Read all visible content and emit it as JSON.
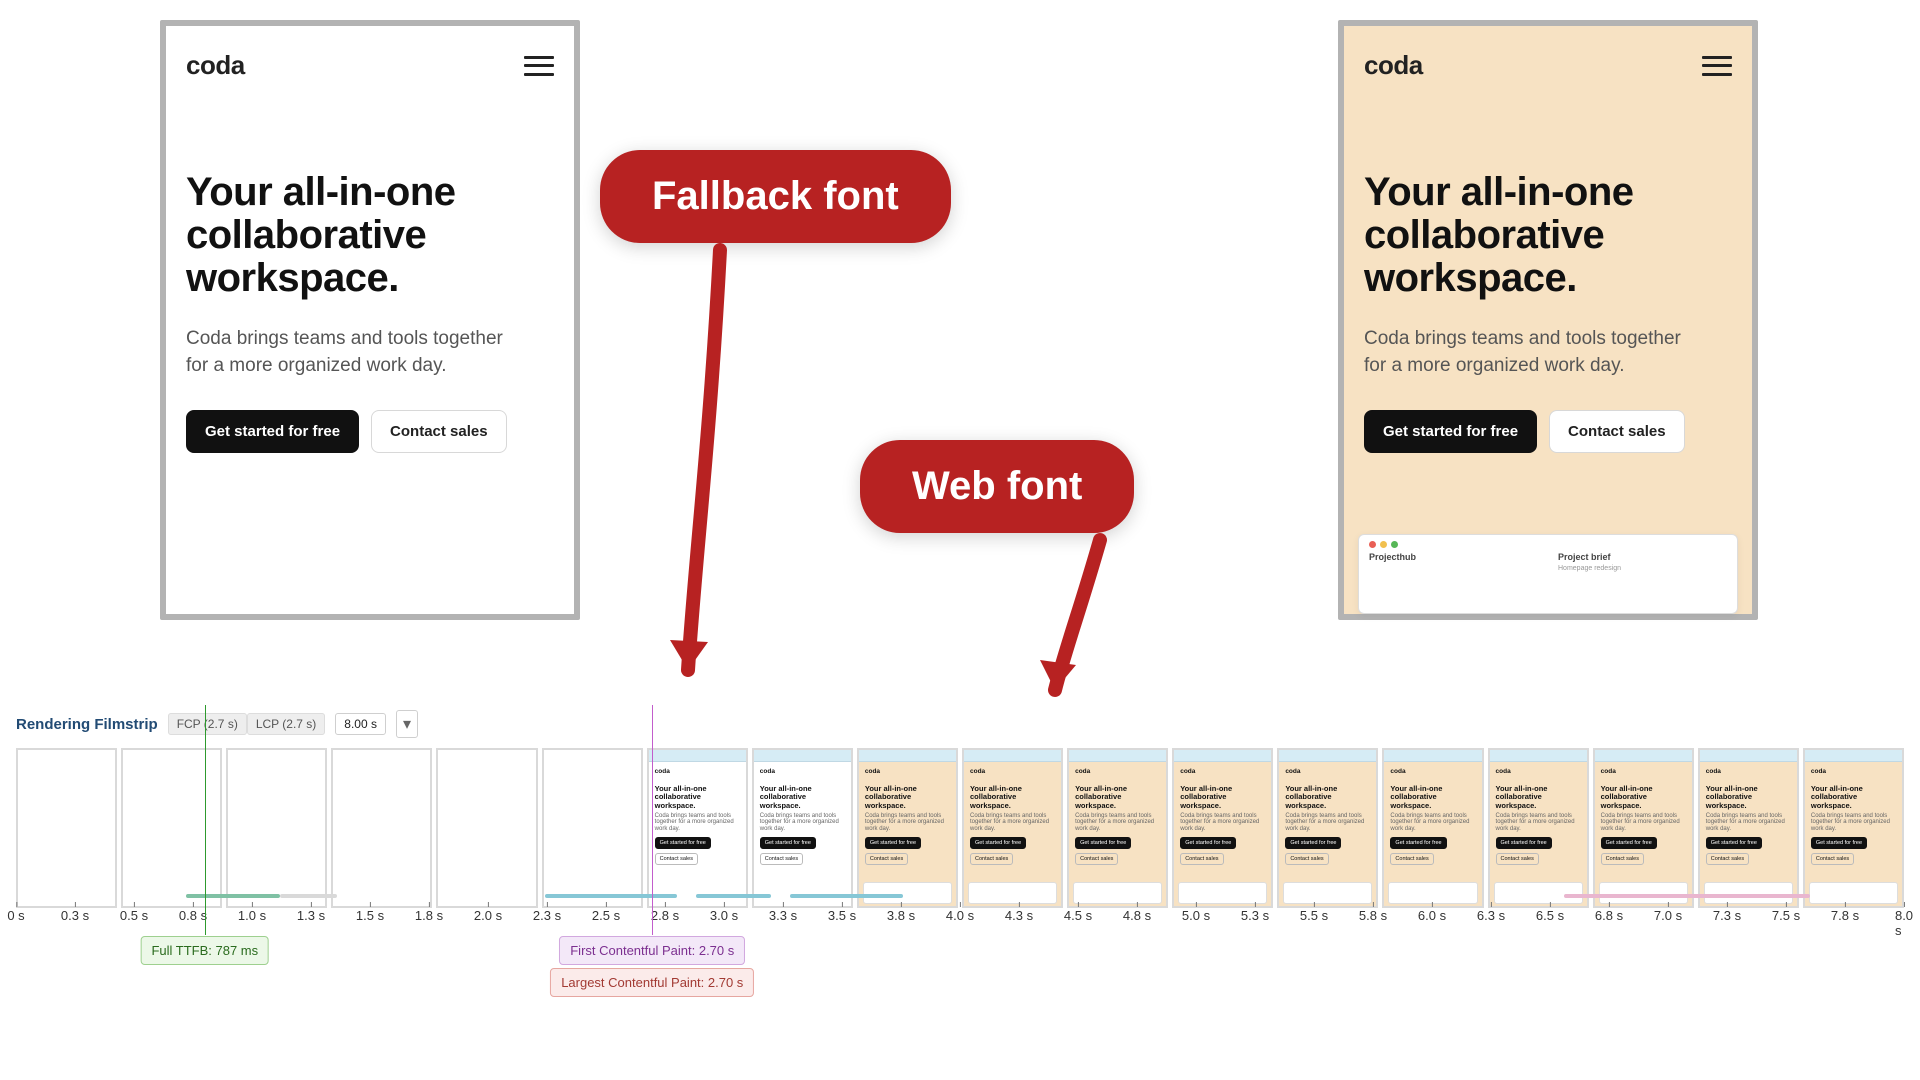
{
  "callouts": {
    "fallback": "Fallback font",
    "webfont": "Web font"
  },
  "screenshot": {
    "brand": "coda",
    "hero": "Your all-in-one collaborative workspace.",
    "sub": "Coda brings teams and tools together for a more organized work day.",
    "btn_primary": "Get started for free",
    "btn_secondary": "Contact sales",
    "mini": {
      "left": "Projecthub",
      "right_h": "Project brief",
      "right_sub": "Homepage redesign"
    }
  },
  "filmstrip": {
    "title": "Rendering Filmstrip",
    "chips": [
      "FCP (2.7 s)",
      "LCP (2.7 s)"
    ],
    "range": "8.00 s",
    "ticks": [
      "0 s",
      "0.3 s",
      "0.5 s",
      "0.8 s",
      "1.0 s",
      "1.3 s",
      "1.5 s",
      "1.8 s",
      "2.0 s",
      "2.3 s",
      "2.5 s",
      "2.8 s",
      "3.0 s",
      "3.3 s",
      "3.5 s",
      "3.8 s",
      "4.0 s",
      "4.3 s",
      "4.5 s",
      "4.8 s",
      "5.0 s",
      "5.3 s",
      "5.5 s",
      "5.8 s",
      "6.0 s",
      "6.3 s",
      "6.5 s",
      "6.8 s",
      "7.0 s",
      "7.3 s",
      "7.5 s",
      "7.8 s",
      "8.0 s"
    ],
    "frames": [
      {
        "state": "blank"
      },
      {
        "state": "blank"
      },
      {
        "state": "blank"
      },
      {
        "state": "blank"
      },
      {
        "state": "blank"
      },
      {
        "state": "blank"
      },
      {
        "state": "fallback"
      },
      {
        "state": "fallback"
      },
      {
        "state": "webfont"
      },
      {
        "state": "webfont"
      },
      {
        "state": "webfont"
      },
      {
        "state": "webfont"
      },
      {
        "state": "webfont"
      },
      {
        "state": "webfont"
      },
      {
        "state": "webfont"
      },
      {
        "state": "webfont"
      },
      {
        "state": "webfont"
      },
      {
        "state": "webfont"
      }
    ],
    "markers": {
      "ttfb": {
        "pos_pct": 10.0,
        "label": "Full TTFB: 787 ms"
      },
      "fcp": {
        "pos_pct": 33.7,
        "label": "First Contentful Paint: 2.70 s"
      },
      "lcp": {
        "pos_pct": 33.7,
        "label": "Largest Contentful Paint: 2.70 s"
      }
    }
  },
  "colors": {
    "accent": "#b72222",
    "beige": "#f7e2c3"
  }
}
